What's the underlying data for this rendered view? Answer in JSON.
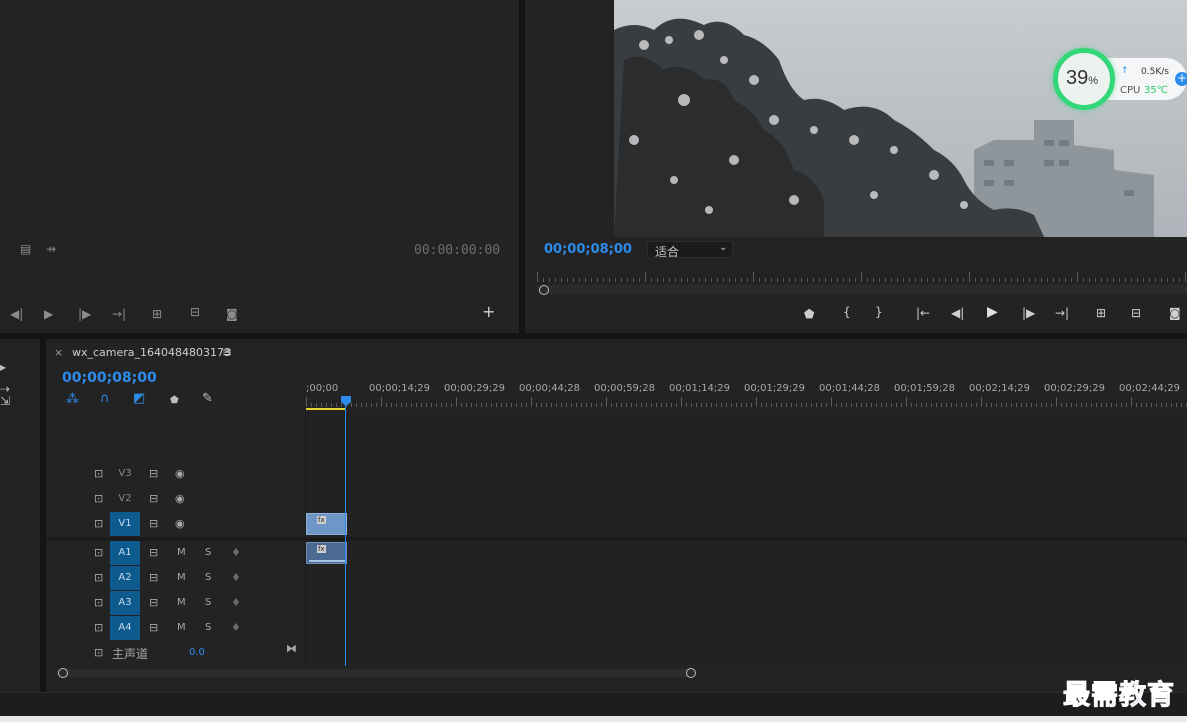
{
  "source_monitor": {
    "timecode": "00:00:00:00"
  },
  "program_monitor": {
    "timecode": "00;00;08;00",
    "zoom_select": "适合"
  },
  "cpu_widget": {
    "percent": "39",
    "percent_sign": "%",
    "net_speed": "0.5K/s",
    "cpu_label": "CPU",
    "cpu_temp": "35℃"
  },
  "timeline": {
    "close_glyph": "×",
    "sequence_name": "wx_camera_1640484803173",
    "menu_glyph": "≡",
    "timecode": "00;00;08;00",
    "ruler_labels": [
      ";00;00",
      "00;00;14;29",
      "00;00;29;29",
      "00;00;44;28",
      "00;00;59;28",
      "00;01;14;29",
      "00;01;29;29",
      "00;01;44;28",
      "00;01;59;28",
      "00;02;14;29",
      "00;02;29;29",
      "00;02;44;29"
    ],
    "video_tracks": [
      "V3",
      "V2",
      "V1"
    ],
    "audio_tracks": [
      "A1",
      "A2",
      "A3",
      "A4"
    ],
    "mute_label": "M",
    "solo_label": "S",
    "master_label": "主声道",
    "master_value": "0.0",
    "clip_badge": "fx"
  },
  "watermark": "最需教育",
  "colors": {
    "accent_blue": "#2d8ceb",
    "track_active": "#0c5a8e",
    "clip_video": "#6e97c8",
    "clip_audio": "#4a6a93",
    "cpu_ring": "#34d67a",
    "cpu_temp": "#2fcf6b"
  }
}
